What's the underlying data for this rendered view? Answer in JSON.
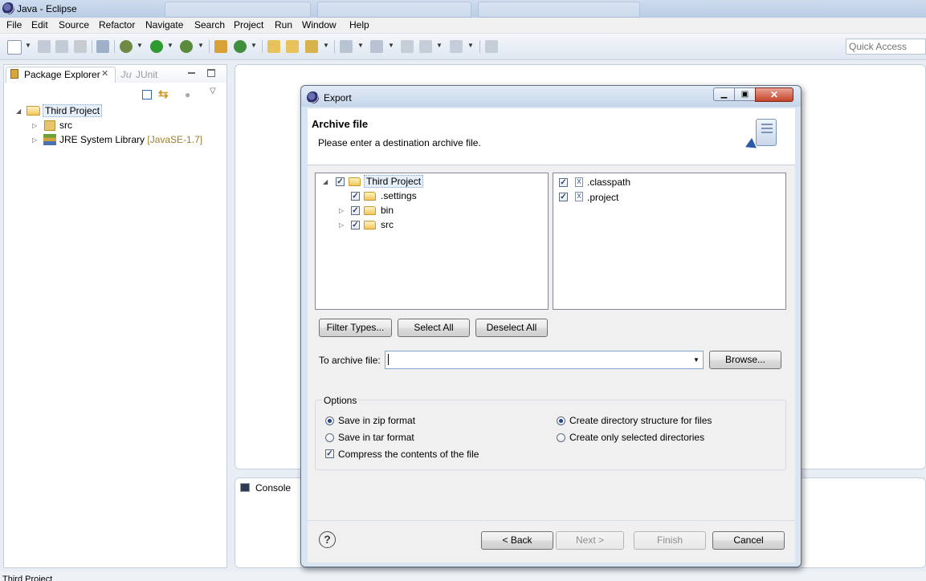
{
  "window": {
    "title": "Java - Eclipse",
    "quick_access_placeholder": "Quick Access"
  },
  "menu": [
    "File",
    "Edit",
    "Source",
    "Refactor",
    "Navigate",
    "Search",
    "Project",
    "Run",
    "Window",
    "Help"
  ],
  "toolbar_icons": [
    "new-icon",
    "save-icon",
    "save-all-icon",
    "print-icon",
    "skip-breakpoints-icon",
    "debug-icon",
    "run-icon",
    "external-tools-icon",
    "new-java-package-icon",
    "new-java-class-icon",
    "open-type-icon",
    "open-task-icon",
    "search-icon",
    "next-annotation-icon",
    "previous-annotation-icon",
    "back-icon",
    "forward-icon",
    "pin-editor-icon"
  ],
  "package_explorer": {
    "tab_label": "Package Explorer",
    "junit_tab_label": "JUnit",
    "tree": {
      "project": "Third Project",
      "children": [
        {
          "label": "src"
        },
        {
          "label": "JRE System Library",
          "suffix": "[JavaSE-1.7]"
        }
      ]
    }
  },
  "console": {
    "tab_label": "Console"
  },
  "statusbar": {
    "text": "Third Project"
  },
  "dialog": {
    "title": "Export",
    "header_title": "Archive file",
    "header_description": "Please enter a destination archive file.",
    "left_tree": {
      "root": "Third Project",
      "children": [
        ".settings",
        "bin",
        "src"
      ]
    },
    "right_list": [
      ".classpath",
      ".project"
    ],
    "buttons": {
      "filter_types": "Filter Types...",
      "select_all": "Select All",
      "deselect_all": "Deselect All",
      "browse": "Browse...",
      "back": "< Back",
      "next": "Next >",
      "finish": "Finish",
      "cancel": "Cancel"
    },
    "archive_label": "To archive file:",
    "archive_value": "",
    "options": {
      "title": "Options",
      "save_zip": "Save in zip format",
      "save_tar": "Save in tar format",
      "compress": "Compress the contents of the file",
      "create_dir_structure": "Create directory structure for files",
      "create_selected_dirs": "Create only selected directories",
      "format_selected": "zip",
      "structure_selected": "create_dir_structure",
      "compress_checked": true
    }
  }
}
